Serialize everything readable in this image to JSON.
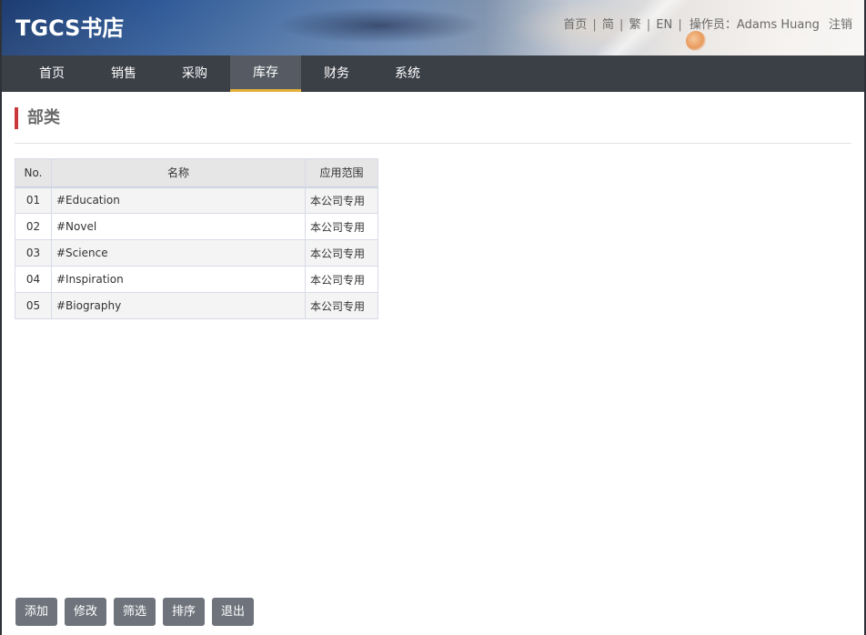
{
  "header": {
    "brand": "TGCS书店",
    "links": {
      "home": "首页",
      "simplified": "简",
      "traditional": "繁",
      "english": "EN",
      "separator": "|",
      "operator_label": "操作员：",
      "operator_name": "Adams Huang",
      "logout": "注销"
    }
  },
  "nav": {
    "items": [
      {
        "label": "首页"
      },
      {
        "label": "销售"
      },
      {
        "label": "采购"
      },
      {
        "label": "库存"
      },
      {
        "label": "财务"
      },
      {
        "label": "系统"
      }
    ],
    "active_index": 3
  },
  "page": {
    "title": "部类"
  },
  "table": {
    "columns": [
      "No.",
      "名称",
      "应用范围"
    ],
    "rows": [
      {
        "no": "01",
        "name": "#Education",
        "scope": "本公司专用"
      },
      {
        "no": "02",
        "name": "#Novel",
        "scope": "本公司专用"
      },
      {
        "no": "03",
        "name": "#Science",
        "scope": "本公司专用"
      },
      {
        "no": "04",
        "name": "#Inspiration",
        "scope": "本公司专用"
      },
      {
        "no": "05",
        "name": "#Biography",
        "scope": "本公司专用"
      }
    ]
  },
  "toolbar": {
    "add": "添加",
    "edit": "修改",
    "filter": "筛选",
    "sort": "排序",
    "exit": "退出"
  },
  "colors": {
    "nav_bg": "#3b3f46",
    "nav_active_bg": "#565b63",
    "nav_active_underline": "#e4b23a",
    "title_accent": "#c9393b",
    "button_bg": "#6f747c"
  }
}
